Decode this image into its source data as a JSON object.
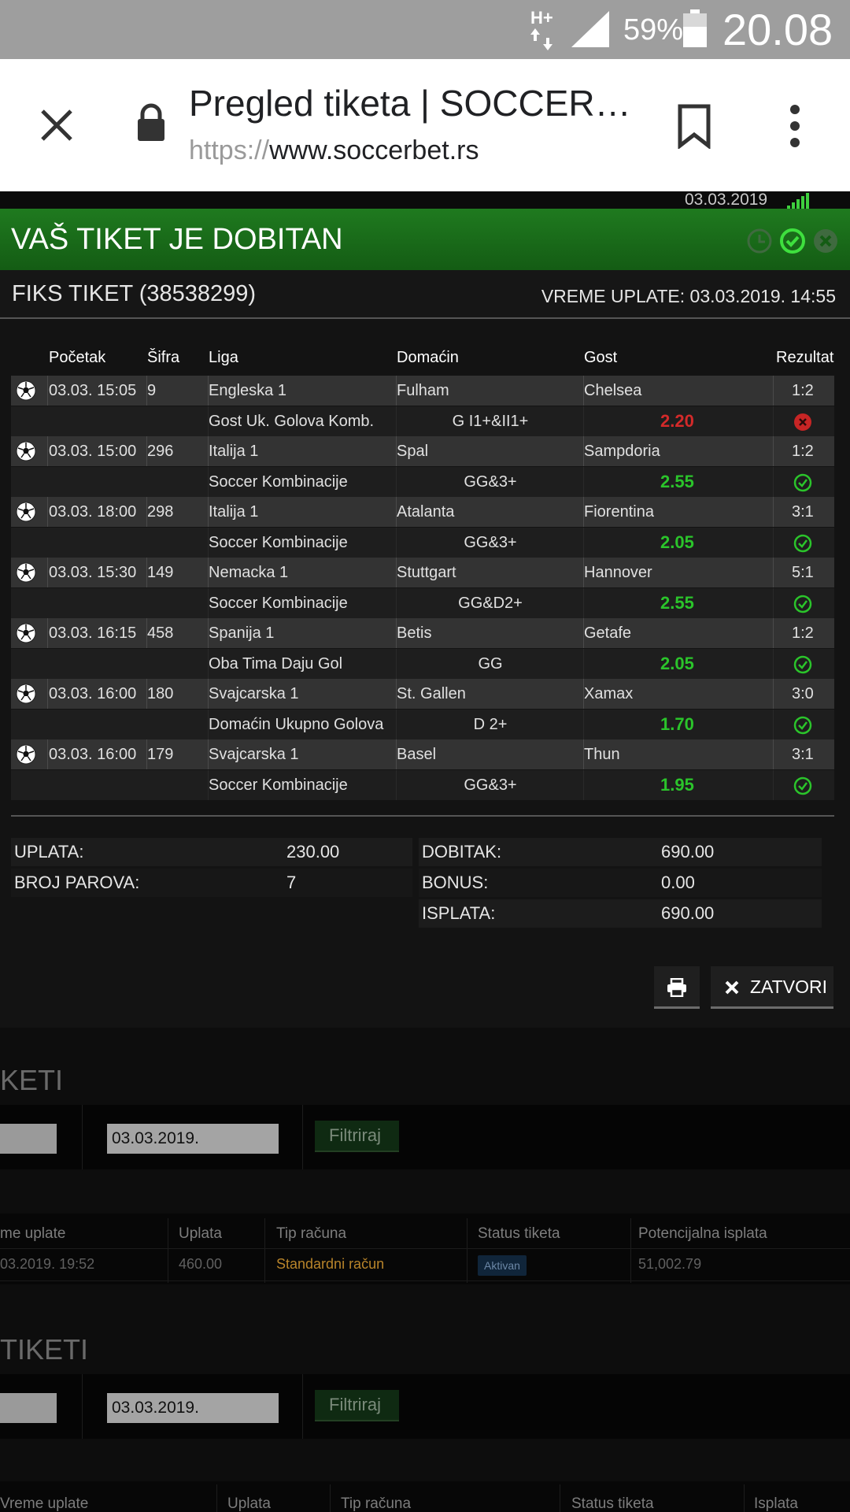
{
  "status_bar": {
    "network": "H+",
    "battery_percent": "59%",
    "time": "20.08"
  },
  "browser": {
    "page_title": "Pregled tiketa | SOCCER…",
    "url_scheme": "https://",
    "url_host": "www.soccerbet.rs"
  },
  "page": {
    "top_date": "03.03.2019"
  },
  "ticket": {
    "header_title": "VAŠ TIKET JE DOBITAN",
    "name": "FIKS TIKET (38538299)",
    "payment_time": "VREME UPLATE: 03.03.2019. 14:55",
    "columns": {
      "start": "Početak",
      "code": "Šifra",
      "league": "Liga",
      "home": "Domaćin",
      "away": "Gost",
      "result": "Rezultat"
    },
    "matches": [
      {
        "start": "03.03. 15:05",
        "code": "9",
        "league": "Engleska 1",
        "home": "Fulham",
        "away": "Chelsea",
        "result": "1:2",
        "bet_type": "Gost Uk. Golova Komb.",
        "pick": "G I1+&II1+",
        "odd": "2.20",
        "status": "lost"
      },
      {
        "start": "03.03. 15:00",
        "code": "296",
        "league": "Italija 1",
        "home": "Spal",
        "away": "Sampdoria",
        "result": "1:2",
        "bet_type": "Soccer Kombinacije",
        "pick": "GG&3+",
        "odd": "2.55",
        "status": "won"
      },
      {
        "start": "03.03. 18:00",
        "code": "298",
        "league": "Italija 1",
        "home": "Atalanta",
        "away": "Fiorentina",
        "result": "3:1",
        "bet_type": "Soccer Kombinacije",
        "pick": "GG&3+",
        "odd": "2.05",
        "status": "won"
      },
      {
        "start": "03.03. 15:30",
        "code": "149",
        "league": "Nemacka 1",
        "home": "Stuttgart",
        "away": "Hannover",
        "result": "5:1",
        "bet_type": "Soccer Kombinacije",
        "pick": "GG&D2+",
        "odd": "2.55",
        "status": "won"
      },
      {
        "start": "03.03. 16:15",
        "code": "458",
        "league": "Spanija 1",
        "home": "Betis",
        "away": "Getafe",
        "result": "1:2",
        "bet_type": "Oba Tima Daju Gol",
        "pick": "GG",
        "odd": "2.05",
        "status": "won"
      },
      {
        "start": "03.03. 16:00",
        "code": "180",
        "league": "Svajcarska 1",
        "home": "St. Gallen",
        "away": "Xamax",
        "result": "3:0",
        "bet_type": "Domaćin Ukupno Golova",
        "pick": "D 2+",
        "odd": "1.70",
        "status": "won"
      },
      {
        "start": "03.03. 16:00",
        "code": "179",
        "league": "Svajcarska 1",
        "home": "Basel",
        "away": "Thun",
        "result": "3:1",
        "bet_type": "Soccer Kombinacije",
        "pick": "GG&3+",
        "odd": "1.95",
        "status": "won"
      }
    ],
    "summary": {
      "stake_label": "UPLATA:",
      "stake_value": "230.00",
      "pairs_label": "BROJ PAROVA:",
      "pairs_value": "7",
      "win_label": "DOBITAK:",
      "win_value": "690.00",
      "bonus_label": "BONUS:",
      "bonus_value": "0.00",
      "payout_label": "ISPLATA:",
      "payout_value": "690.00"
    },
    "close_label": "ZATVORI"
  },
  "background": {
    "section1_title": "KETI",
    "section2_title": "TIKETI",
    "date_value": "03.03.2019.",
    "filter_label": "Filtriraj",
    "table1_headers": [
      "me uplate",
      "Uplata",
      "Tip računa",
      "Status tiketa",
      "Potencijalna isplata"
    ],
    "table1_row": {
      "time": "03.2019. 19:52",
      "stake": "460.00",
      "account": "Standardni račun",
      "status": "Aktivan",
      "payout": "51,002.79"
    },
    "table2_headers": [
      "Vreme uplate",
      "Uplata",
      "Tip računa",
      "Status tiketa",
      "Isplata"
    ]
  },
  "colors": {
    "header_green": "#1f7a1f",
    "odd_win": "#2bc42b",
    "odd_lose": "#d42a2a",
    "account_orange": "#b8842a"
  }
}
